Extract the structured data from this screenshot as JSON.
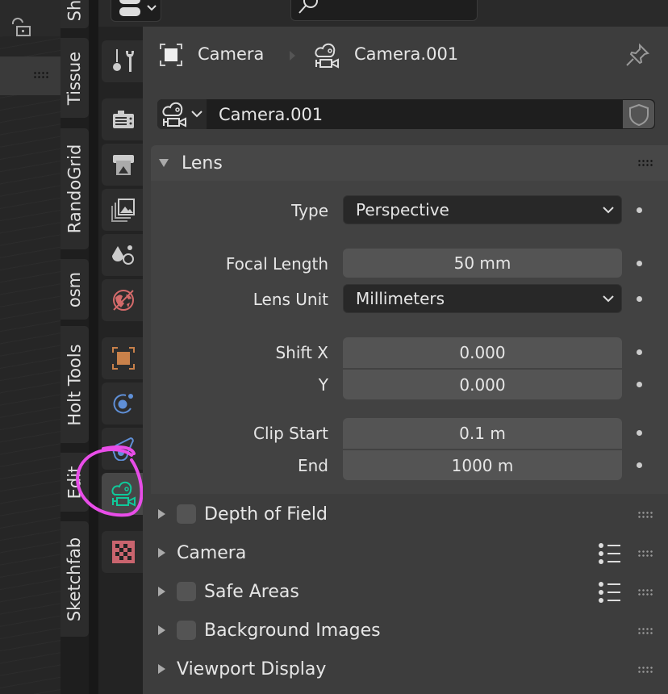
{
  "sidebar_tabs": [
    "Sh",
    "Tissue",
    "RandoGrid",
    "osm",
    "Holt Tools",
    "Edit",
    "Sketchfab"
  ],
  "property_tabs": [
    {
      "icon": "tool-icon"
    },
    {
      "icon": "render-icon"
    },
    {
      "icon": "output-icon"
    },
    {
      "icon": "view-layer-icon"
    },
    {
      "icon": "scene-icon"
    },
    {
      "icon": "world-icon"
    },
    {
      "icon": "object-icon"
    },
    {
      "icon": "physics-icon"
    },
    {
      "icon": "object-constraint-icon"
    },
    {
      "icon": "camera-data-icon",
      "active": true
    },
    {
      "icon": "texture-icon"
    }
  ],
  "breadcrumb": {
    "object": "Camera",
    "data": "Camera.001"
  },
  "datablock": {
    "name": "Camera.001"
  },
  "lens_panel": {
    "title": "Lens",
    "type_label": "Type",
    "type_value": "Perspective",
    "focal_label": "Focal Length",
    "focal_value": "50 mm",
    "unit_label": "Lens Unit",
    "unit_value": "Millimeters",
    "shiftx_label": "Shift X",
    "shiftx_value": "0.000",
    "shifty_label": "Y",
    "shifty_value": "0.000",
    "clipstart_label": "Clip Start",
    "clipstart_value": "0.1 m",
    "clipend_label": "End",
    "clipend_value": "1000 m"
  },
  "subpanels": [
    {
      "label": "Depth of Field",
      "checkbox": true,
      "checked": false
    },
    {
      "label": "Camera",
      "checkbox": false,
      "presets": true
    },
    {
      "label": "Safe Areas",
      "checkbox": true,
      "checked": false,
      "presets": true
    },
    {
      "label": "Background Images",
      "checkbox": true,
      "checked": false
    },
    {
      "label": "Viewport Display",
      "checkbox": false
    }
  ],
  "colors": {
    "active_tab_icon": "#10c99a",
    "annotation": "#e84de8",
    "object_orange": "#c9814a",
    "world_red": "#d46a6a",
    "physics_blue": "#5f8fd6"
  }
}
